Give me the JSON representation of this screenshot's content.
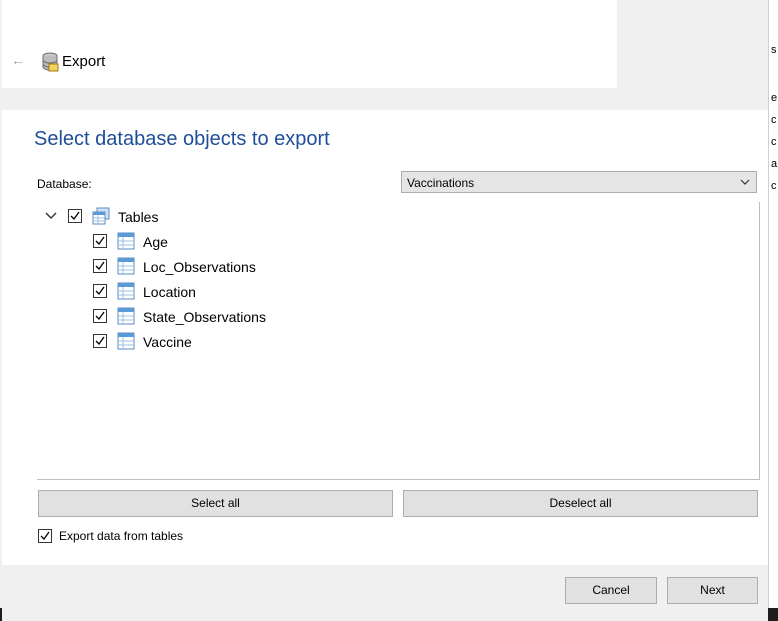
{
  "header": {
    "title": "Export",
    "back_icon": "arrow-left-icon",
    "app_icon": "database-icon"
  },
  "page": {
    "title": "Select database objects to export"
  },
  "database": {
    "label": "Database:",
    "selected": "Vaccinations"
  },
  "tree": {
    "root": {
      "label": "Tables",
      "checked": true,
      "expanded": true
    },
    "items": [
      {
        "label": "Age",
        "checked": true
      },
      {
        "label": "Loc_Observations",
        "checked": true
      },
      {
        "label": "Location",
        "checked": true
      },
      {
        "label": "State_Observations",
        "checked": true
      },
      {
        "label": "Vaccine",
        "checked": true
      }
    ]
  },
  "buttons": {
    "select_all": "Select all",
    "deselect_all": "Deselect all",
    "cancel": "Cancel",
    "next": "Next"
  },
  "options": {
    "export_data_label": "Export data from tables",
    "export_data_checked": true
  },
  "background": {
    "right_fragments": [
      "s",
      "e",
      "c",
      "c",
      "a",
      "c"
    ]
  },
  "colors": {
    "title_blue": "#1f4e99",
    "button_bg": "#e1e1e1",
    "dialog_bg": "#f0f0f0"
  }
}
